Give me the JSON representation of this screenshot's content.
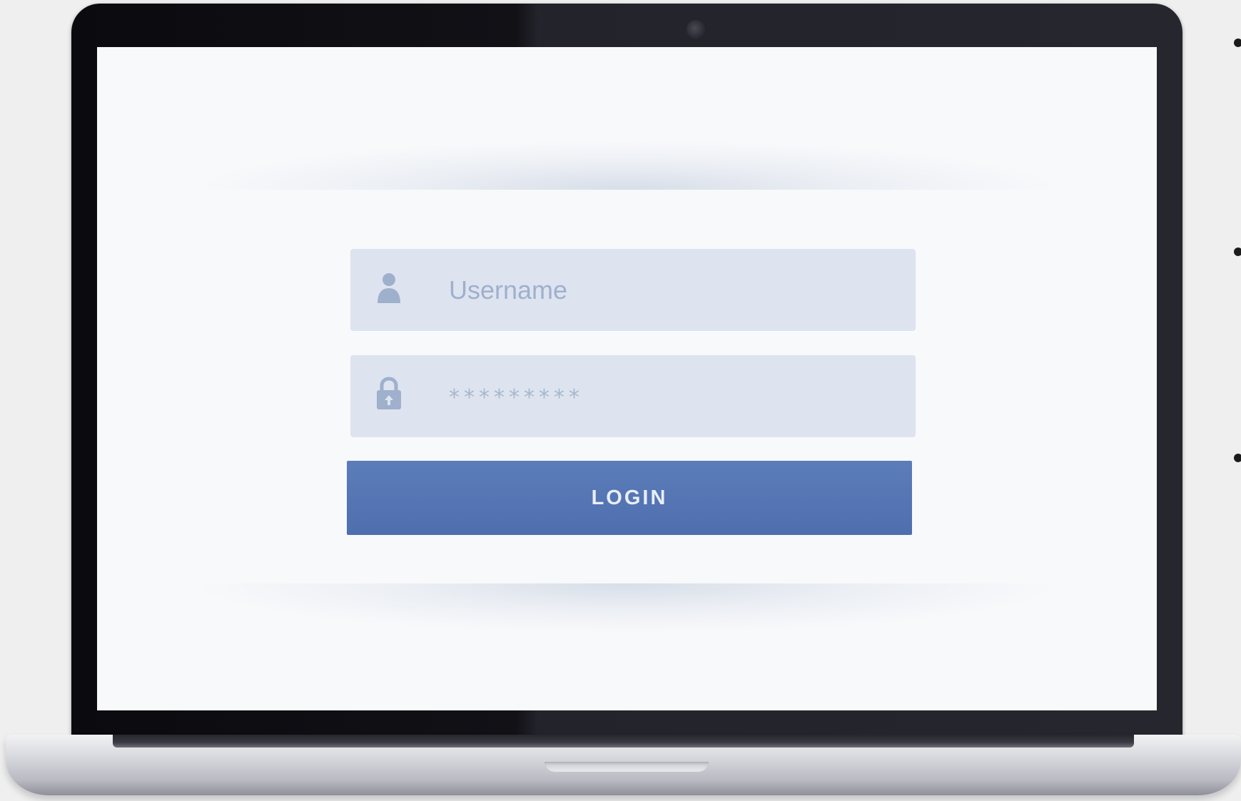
{
  "login_form": {
    "username": {
      "placeholder": "Username",
      "icon": "user-icon"
    },
    "password": {
      "masked_value": "*********",
      "icon": "lock-icon"
    },
    "login_button_label": "LOGIN"
  },
  "colors": {
    "screen_background": "#f8f9fb",
    "field_background": "#dde4ef",
    "icon_color": "#9fb0cd",
    "button_background": "#5677b5",
    "button_text": "#e8eef8"
  }
}
